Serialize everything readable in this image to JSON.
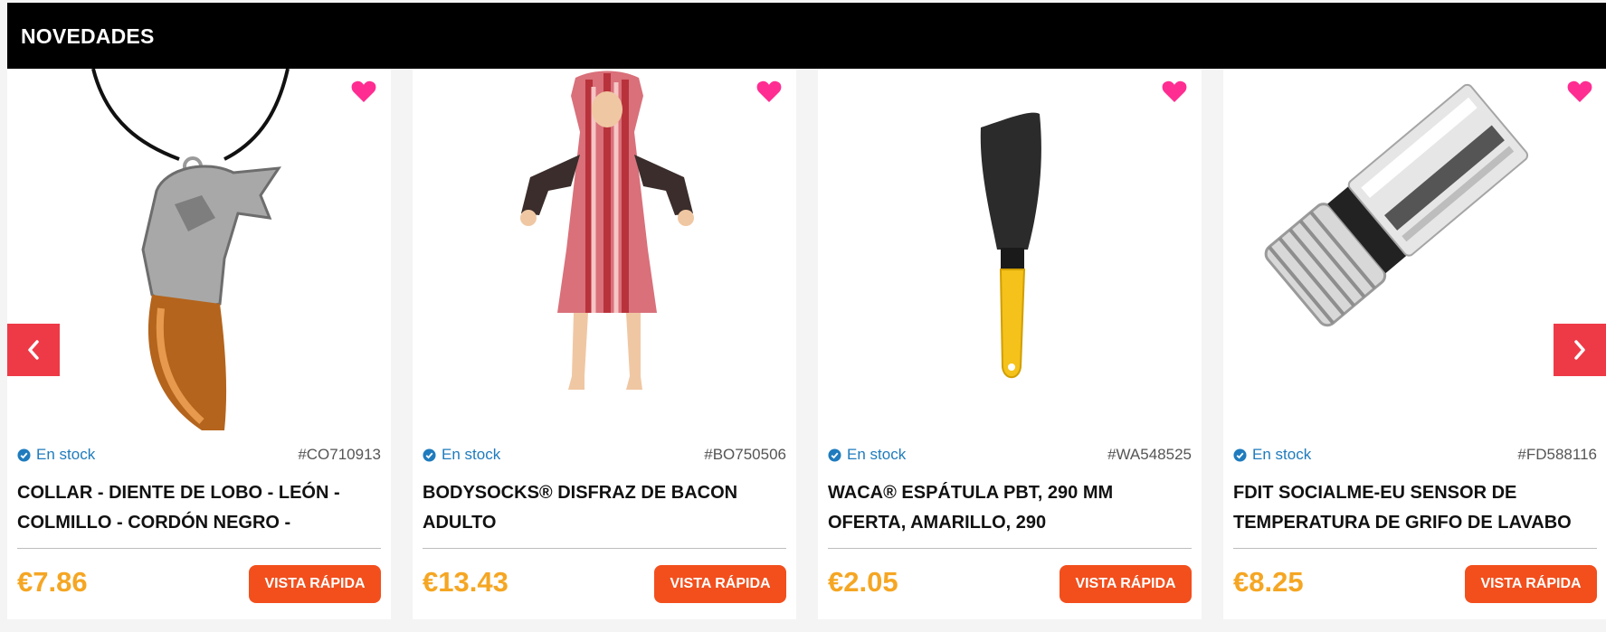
{
  "section": {
    "title": "NOVEDADES"
  },
  "colors": {
    "accent_price": "#f5a623",
    "button": "#f24f1d",
    "arrow": "#ee3a47",
    "heart": "#ff2d91",
    "stock": "#1f7bbd"
  },
  "carousel": {
    "prev_icon": "chevron-left-icon",
    "next_icon": "chevron-right-icon"
  },
  "products": [
    {
      "image": "wolf-fang-necklace-image",
      "stock": "En stock",
      "sku": "#CO710913",
      "title": "COLLAR - DIENTE DE LOBO - LEÓN - COLMILLO - CORDÓN NEGRO -",
      "price": "€7.86",
      "button": "VISTA RÁPIDA"
    },
    {
      "image": "bacon-costume-image",
      "stock": "En stock",
      "sku": "#BO750506",
      "title": "BODYSOCKS® DISFRAZ DE BACON ADULTO",
      "price": "€13.43",
      "button": "VISTA RÁPIDA"
    },
    {
      "image": "spatula-image",
      "stock": "En stock",
      "sku": "#WA548525",
      "title": "WACA® ESPÁTULA PBT, 290 MM OFERTA, AMARILLO, 290",
      "price": "€2.05",
      "button": "VISTA RÁPIDA"
    },
    {
      "image": "faucet-sensor-image",
      "stock": "En stock",
      "sku": "#FD588116",
      "title": "FDIT SOCIALME-EU SENSOR DE TEMPERATURA DE GRIFO DE LAVABO",
      "price": "€8.25",
      "button": "VISTA RÁPIDA"
    }
  ]
}
